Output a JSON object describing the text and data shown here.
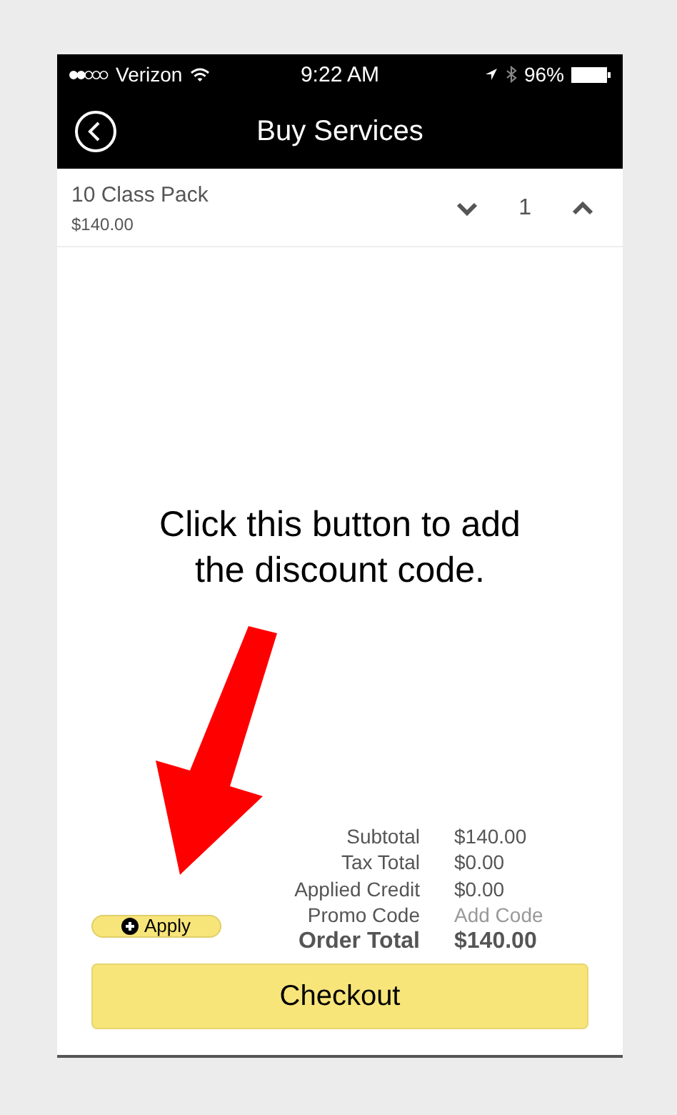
{
  "status_bar": {
    "carrier": "Verizon",
    "time": "9:22 AM",
    "battery": "96%"
  },
  "nav": {
    "title": "Buy Services"
  },
  "item": {
    "name": "10 Class Pack",
    "price": "$140.00",
    "quantity": "1"
  },
  "annotation": "Click this button to add the discount code.",
  "apply_button": {
    "label": "Apply"
  },
  "totals": [
    {
      "label": "Subtotal",
      "value": "$140.00",
      "kind": "amount"
    },
    {
      "label": "Tax Total",
      "value": "$0.00",
      "kind": "amount"
    },
    {
      "label": "Applied Credit",
      "value": "$0.00",
      "kind": "amount"
    },
    {
      "label": "Promo Code",
      "value": "Add Code",
      "kind": "link"
    },
    {
      "label": "Order Total",
      "value": "$140.00",
      "kind": "total"
    }
  ],
  "checkout_button": "Checkout"
}
